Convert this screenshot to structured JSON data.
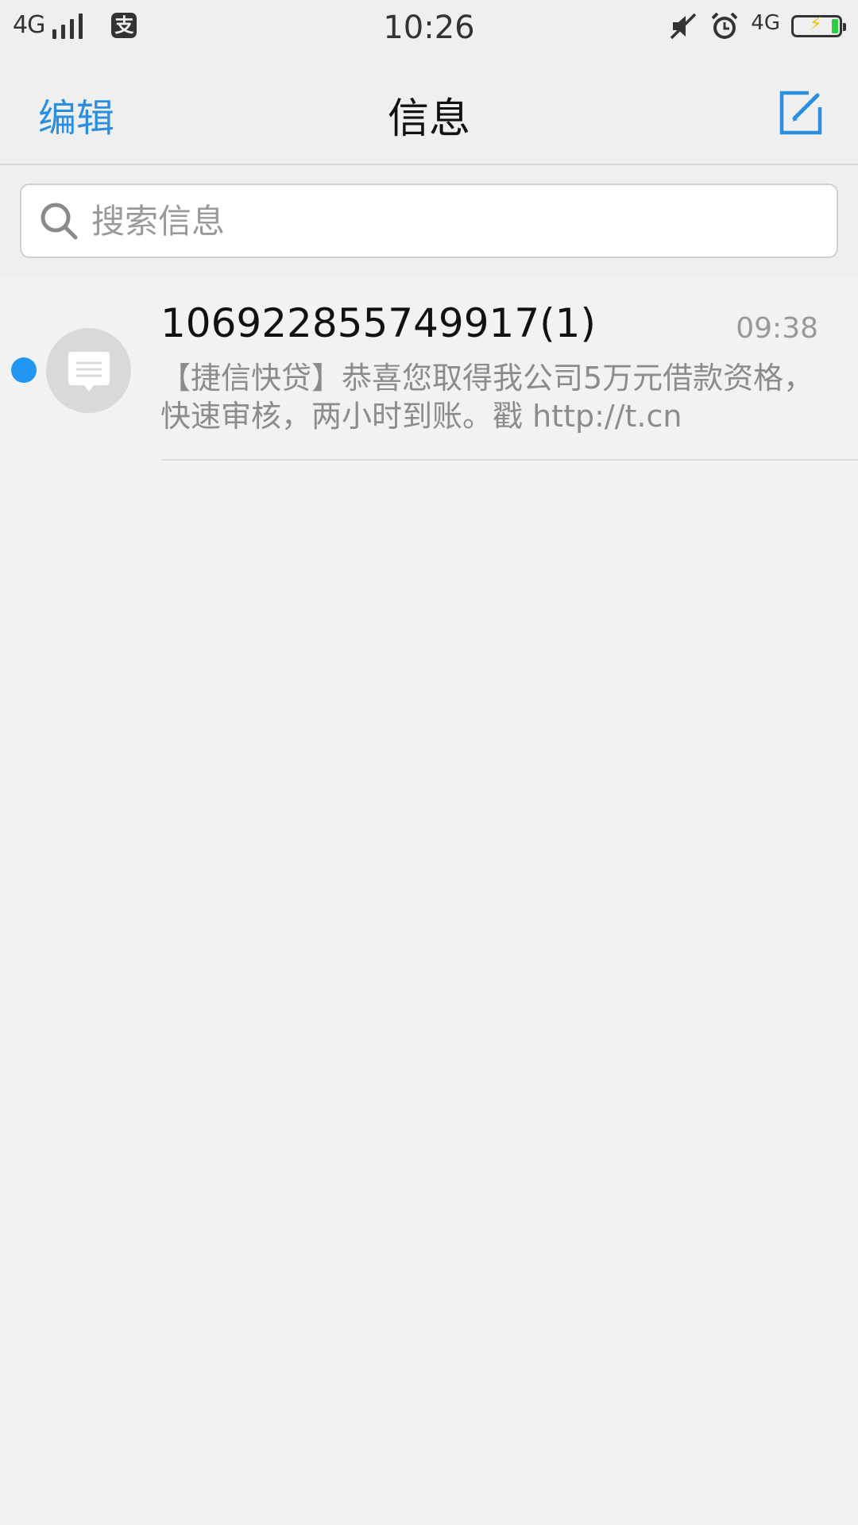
{
  "status_bar": {
    "network_left": "4G",
    "alipay_glyph": "支",
    "time": "10:26",
    "network_right": "4G",
    "battery_level": 0.15,
    "icons": [
      "signal-icon",
      "alipay-icon",
      "muted-icon",
      "alarm-icon",
      "battery-icon"
    ]
  },
  "nav": {
    "edit_label": "编辑",
    "title": "信息",
    "compose_icon": "compose-icon"
  },
  "search": {
    "placeholder": "搜索信息",
    "value": ""
  },
  "conversations": [
    {
      "sender": "106922855749917(1)",
      "time": "09:38",
      "preview": "【捷信快贷】恭喜您取得我公司5万元借款资格，快速审核，两小时到账。戳 http://t.cn",
      "unread": true
    }
  ],
  "colors": {
    "accent": "#2a8fe0",
    "unread_dot": "#2196f3",
    "background": "#f2f2f2",
    "battery_fill": "#2ecc40"
  }
}
